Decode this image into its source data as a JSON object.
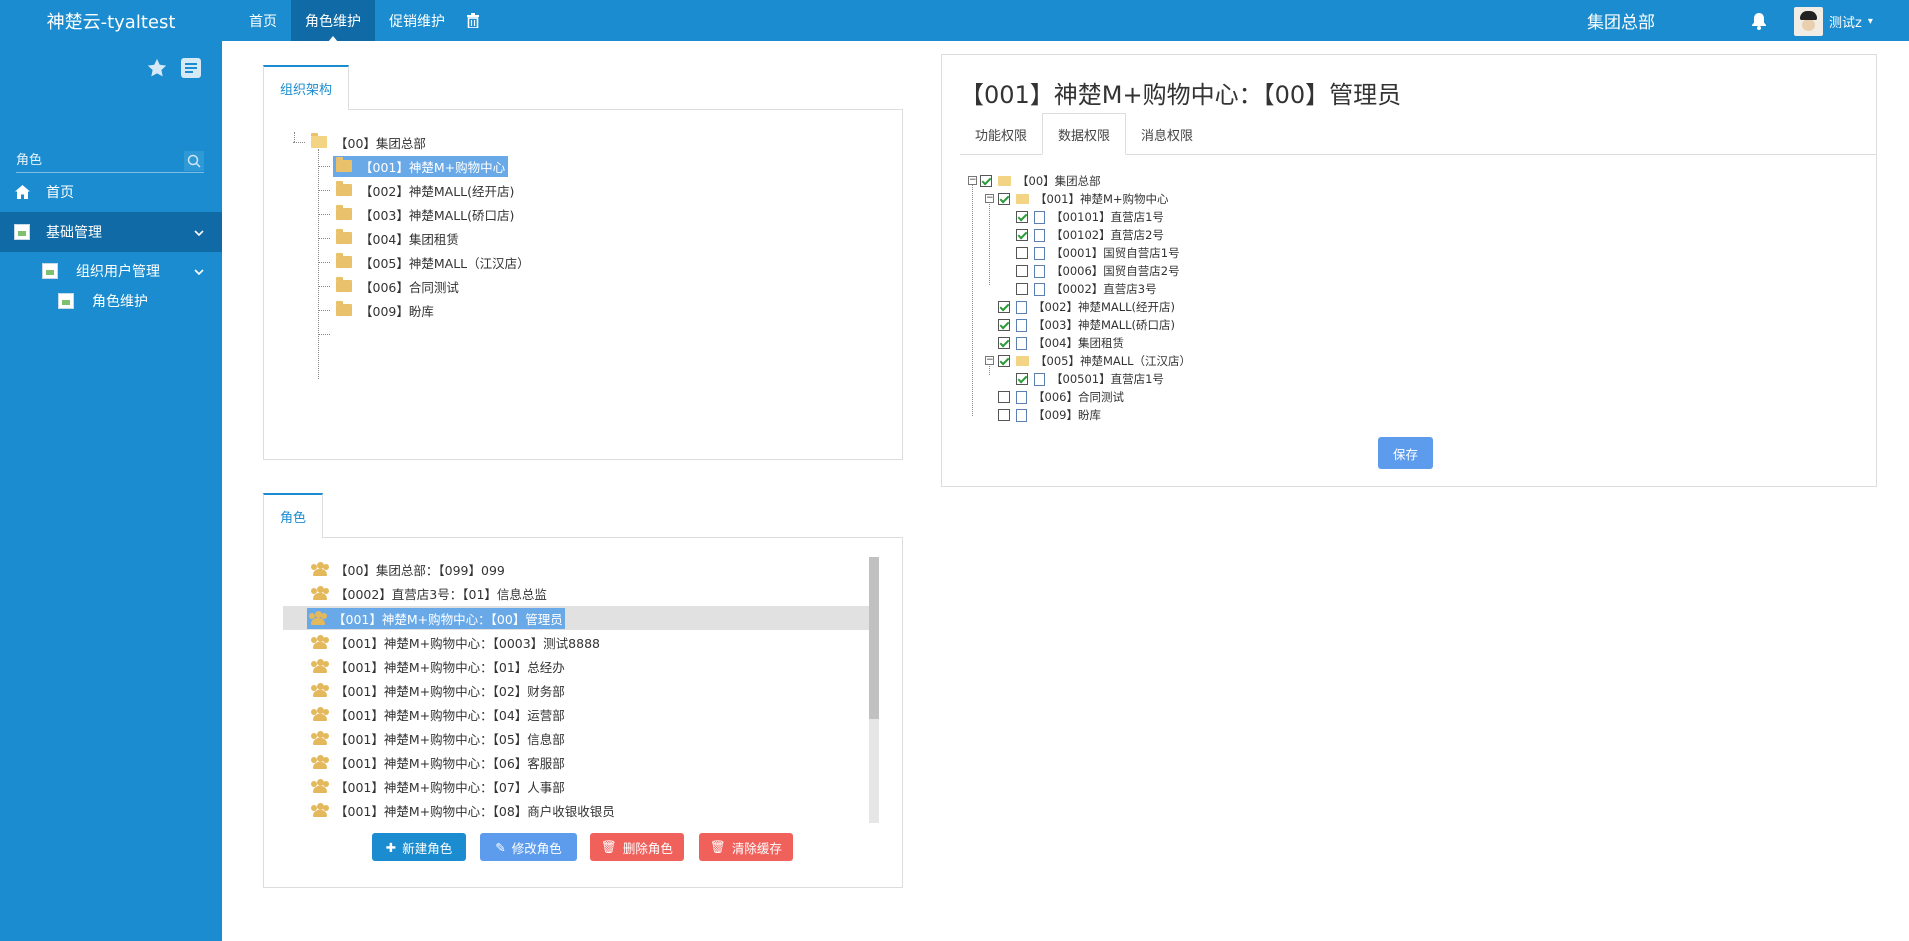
{
  "topbar": {
    "brand": "神楚云-tyaltest",
    "nav": [
      "首页",
      "角色维护",
      "促销维护"
    ],
    "org": "集团总部",
    "user": "测试z"
  },
  "sidebar": {
    "search_placeholder": "角色",
    "items": [
      "首页",
      "基础管理",
      "组织用户管理",
      "角色维护"
    ]
  },
  "org_tree": {
    "tab": "组织架构",
    "root": "【00】集团总部",
    "children": [
      "【001】神楚M+购物中心",
      "【002】神楚MALL(经开店)",
      "【003】神楚MALL(硚口店)",
      "【004】集团租赁",
      "【005】神楚MALL（江汉店）",
      "【006】合同测试",
      "【009】盼库"
    ]
  },
  "roles": {
    "tab": "角色",
    "items": [
      "【00】集团总部：【099】099",
      "【0002】直营店3号：【01】信息总监",
      "【001】神楚M+购物中心：【00】管理员",
      "【001】神楚M+购物中心：【0003】测试8888",
      "【001】神楚M+购物中心：【01】总经办",
      "【001】神楚M+购物中心：【02】财务部",
      "【001】神楚M+购物中心：【04】运营部",
      "【001】神楚M+购物中心：【05】信息部",
      "【001】神楚M+购物中心：【06】客服部",
      "【001】神楚M+购物中心：【07】人事部",
      "【001】神楚M+购物中心：【08】商户收银收银员"
    ],
    "buttons": [
      "新建角色",
      "修改角色",
      "删除角色",
      "清除缓存"
    ]
  },
  "permissions": {
    "title": "【001】神楚M+购物中心：【00】管理员",
    "tabs": [
      "功能权限",
      "数据权限",
      "消息权限"
    ],
    "tree": [
      {
        "label": "【00】集团总部",
        "checked": true
      },
      {
        "label": "【001】神楚M+购物中心",
        "checked": true
      },
      {
        "label": "【00101】直营店1号",
        "checked": true
      },
      {
        "label": "【00102】直营店2号",
        "checked": true
      },
      {
        "label": "【0001】国贸自营店1号",
        "checked": false
      },
      {
        "label": "【0006】国贸自营店2号",
        "checked": false
      },
      {
        "label": "【0002】直营店3号",
        "checked": false
      },
      {
        "label": "【002】神楚MALL(经开店)",
        "checked": true
      },
      {
        "label": "【003】神楚MALL(硚口店)",
        "checked": true
      },
      {
        "label": "【004】集团租赁",
        "checked": true
      },
      {
        "label": "【005】神楚MALL（江汉店）",
        "checked": true
      },
      {
        "label": "【00501】直营店1号",
        "checked": true
      },
      {
        "label": "【006】合同测试",
        "checked": false
      },
      {
        "label": "【009】盼库",
        "checked": false
      }
    ],
    "save": "保存"
  }
}
